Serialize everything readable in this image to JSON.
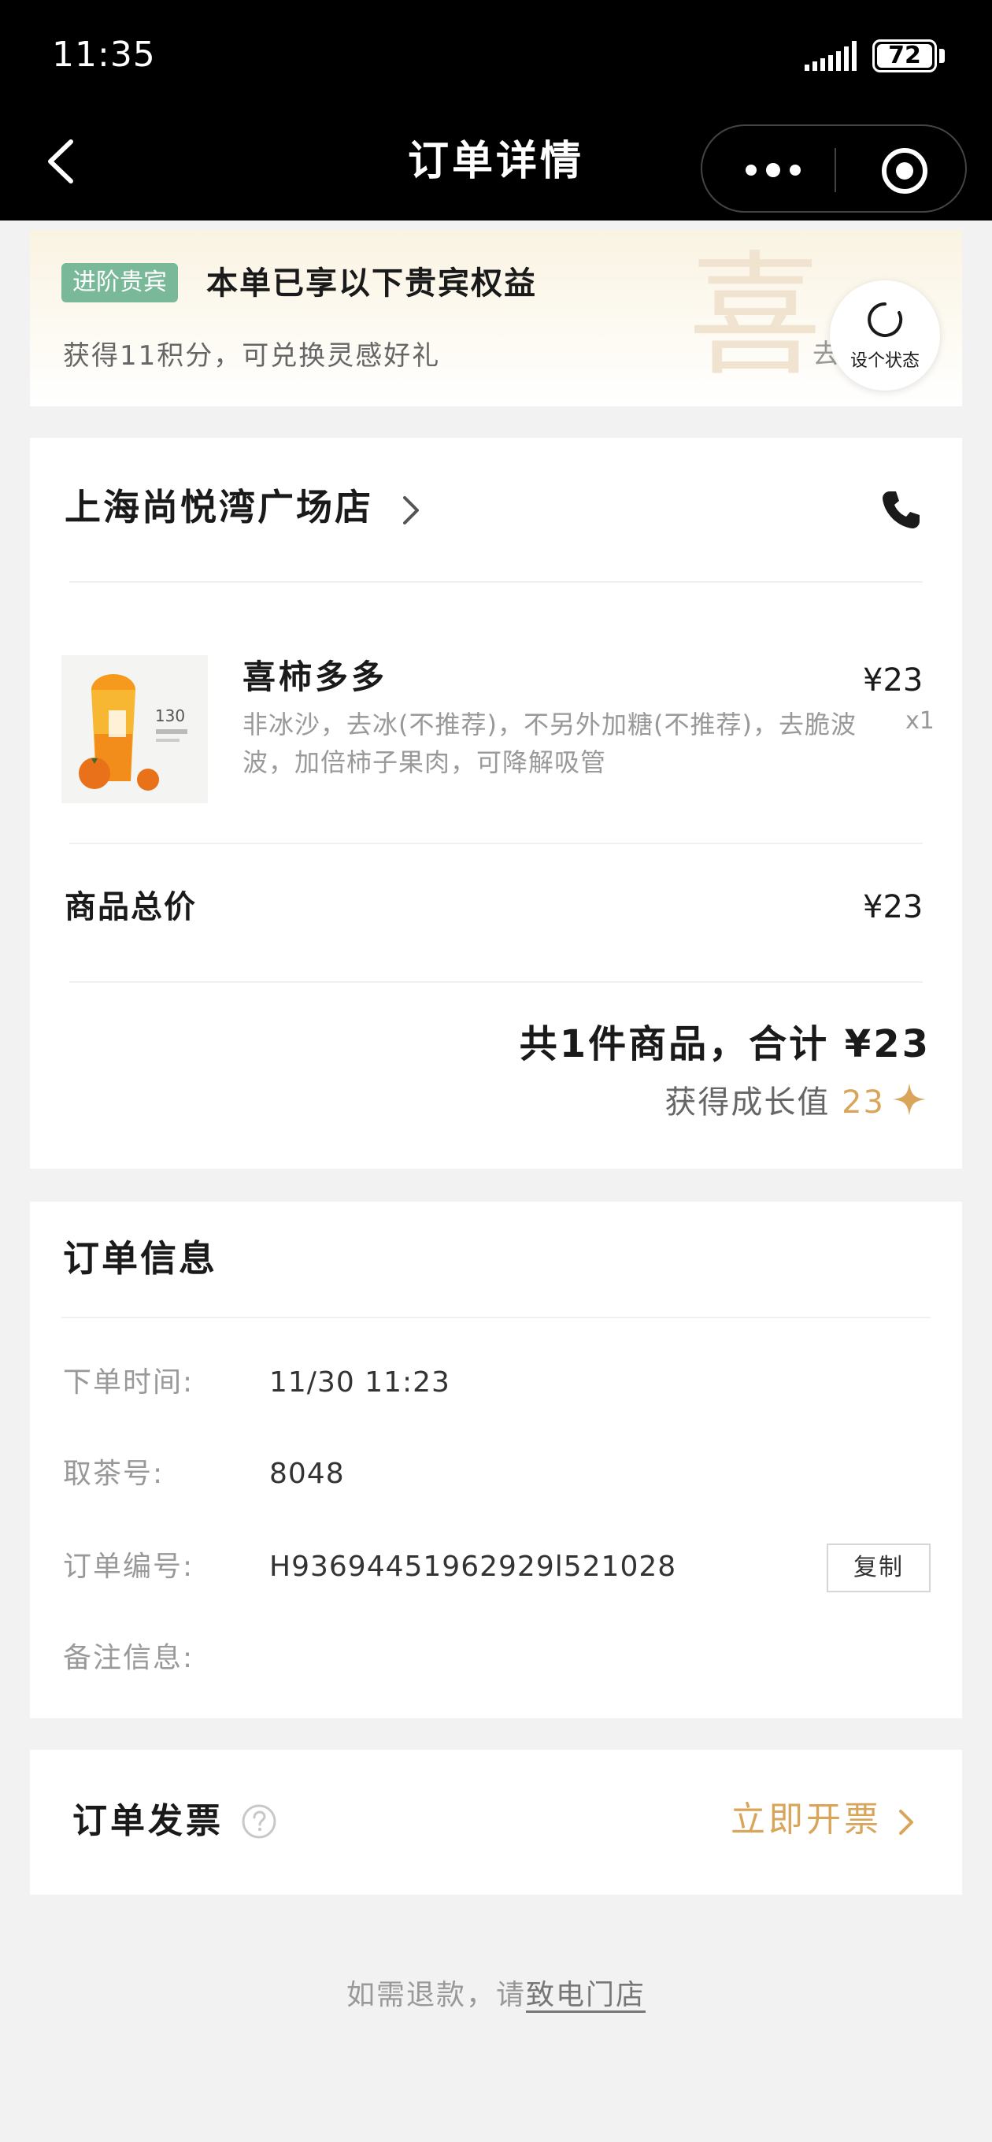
{
  "status_bar": {
    "time": "11:35",
    "battery": "72"
  },
  "nav": {
    "title": "订单详情"
  },
  "vip": {
    "tag": "进阶贵宾",
    "title": "本单已享以下贵宾权益",
    "subtitle": "获得11积分，可兑换灵感好礼",
    "watermark": "喜",
    "action": "去"
  },
  "floating_button": {
    "label": "设个状态"
  },
  "store": {
    "name": "上海尚悦湾广场店"
  },
  "product": {
    "name": "喜柿多多",
    "options": "非冰沙，去冰(不推荐)，不另外加糖(不推荐)，去脆波波，加倍柿子果肉，可降解吸管",
    "price": "¥23",
    "quantity": "x1",
    "cup_text": "130"
  },
  "summary": {
    "subtotal_label": "商品总价",
    "subtotal_value": "¥23",
    "total_line": "共1件商品，合计 ¥23",
    "growth_label": "获得成长值",
    "growth_value": "23"
  },
  "order_info": {
    "title": "订单信息",
    "rows": [
      {
        "label": "下单时间:",
        "value": "11/30 11:23"
      },
      {
        "label": "取茶号:",
        "value": "8048"
      },
      {
        "label": "订单编号:",
        "value": "H93694451962929l521028"
      },
      {
        "label": "备注信息:",
        "value": ""
      }
    ],
    "copy_label": "复制"
  },
  "invoice": {
    "title": "订单发票",
    "action": "立即开票"
  },
  "footer": {
    "refund_prefix": "如需退款，请",
    "refund_link": "致电门店"
  },
  "colors": {
    "accent": "#d9a55a",
    "vip_tag": "#79b898",
    "topbar": "#000000",
    "page_bg": "#f2f2f2"
  },
  "icons": [
    "back-icon",
    "more-icon",
    "target-icon",
    "signal-icon",
    "battery-icon",
    "loading-circle-icon",
    "chevron-right-icon",
    "phone-icon",
    "sparkle-icon",
    "help-icon"
  ]
}
